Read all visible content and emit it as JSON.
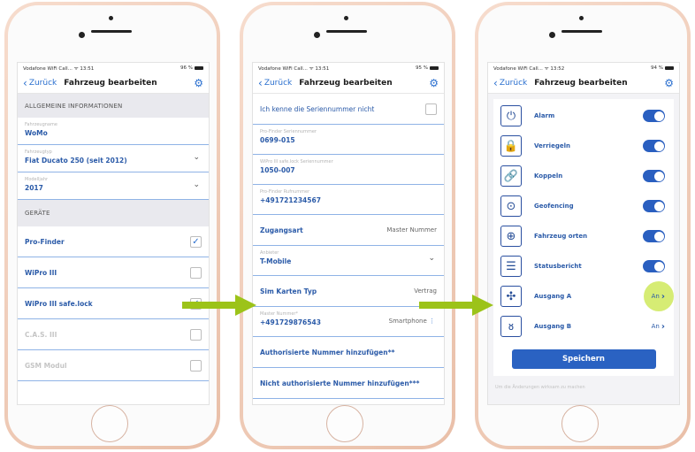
{
  "status": {
    "carrier": "Vodafone WiFi Call...",
    "wifi": "wifi",
    "p1_time": "13:51",
    "p1_battery": "96 %",
    "p2_time": "13:51",
    "p2_battery": "95 %",
    "p3_time": "13:52",
    "p3_battery": "94 %"
  },
  "nav": {
    "back": "Zurück",
    "title": "Fahrzeug bearbeiten",
    "gear_icon": "gear-icon"
  },
  "phone1": {
    "section_general": "ALLGEMEINE INFORMATIONEN",
    "fields": [
      {
        "label": "Fahrzeugname",
        "value": "WoMo"
      },
      {
        "label": "Fahrzeugtyp",
        "value": "Fiat Ducato 250 (seit 2012)"
      },
      {
        "label": "Modelljahr",
        "value": "2017"
      }
    ],
    "section_devices": "GERÄTE",
    "devices": [
      {
        "label": "Pro-Finder",
        "checked": "✓"
      },
      {
        "label": "WiPro III",
        "checked": ""
      },
      {
        "label": "WiPro III safe.lock",
        "checked": "✓"
      },
      {
        "label": "C.A.S. III",
        "checked": ""
      },
      {
        "label": "GSM Modul",
        "checked": ""
      }
    ]
  },
  "phone2": {
    "serial_unknown": "Ich kenne die Seriennummer nicht",
    "fields": [
      {
        "label": "Pro-Finder Seriennummer",
        "value": "0699-015"
      },
      {
        "label": "WiPro III safe.lock Seriennummer",
        "value": "1050-007"
      },
      {
        "label": "Pro-Finder Rufnummer",
        "value": "+491721234567"
      }
    ],
    "access_label": "Zugangsart",
    "access_value": "Master Nummer",
    "provider_label": "Anbieter",
    "provider_value": "T-Mobile",
    "sim_label": "Sim Karten Typ",
    "sim_value": "Vertrag",
    "master_label": "Master Nummer*",
    "master_value": "+491729876543",
    "master_device": "Smartphone",
    "add_authorized": "Authorisierte Nummer hinzufügen**",
    "add_unauthorized": "Nicht authorisierte Nummer hinzufügen***"
  },
  "phone3": {
    "items": [
      {
        "label": "Alarm",
        "icon": "power-icon",
        "glyph": "⏻",
        "control": "toggle"
      },
      {
        "label": "Verriegeln",
        "icon": "lock-icon",
        "glyph": "🔒",
        "control": "toggle"
      },
      {
        "label": "Koppeln",
        "icon": "link-icon",
        "glyph": "🔗",
        "control": "toggle"
      },
      {
        "label": "Geofencing",
        "icon": "location-pin-icon",
        "glyph": "⊙",
        "control": "toggle"
      },
      {
        "label": "Fahrzeug orten",
        "icon": "target-icon",
        "glyph": "⊕",
        "control": "toggle"
      },
      {
        "label": "Statusbericht",
        "icon": "checklist-icon",
        "glyph": "☰",
        "control": "toggle"
      },
      {
        "label": "Ausgang A",
        "icon": "fan-icon",
        "glyph": "✣",
        "control": "An"
      },
      {
        "label": "Ausgang B",
        "icon": "coil-icon",
        "glyph": "ᴕ",
        "control": "An"
      }
    ],
    "save": "Speichern",
    "footer_hint": "Um die Änderungen wirksam zu machen"
  },
  "colors": {
    "accent": "#2a62c2",
    "highlight": "#c8e646",
    "arrow": "#9cc319"
  }
}
